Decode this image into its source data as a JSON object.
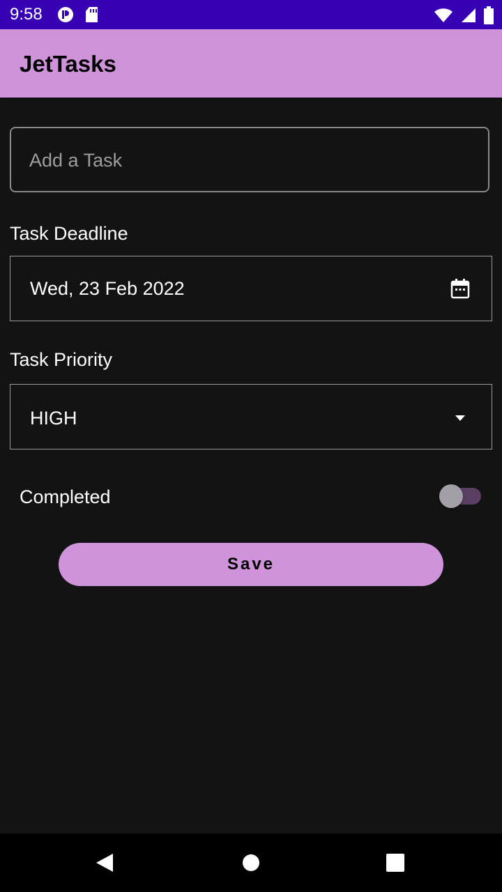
{
  "status_bar": {
    "time": "9:58",
    "icons": [
      "app-notification-icon",
      "sd-card-icon",
      "wifi-icon",
      "signal-icon",
      "battery-icon"
    ],
    "color": "#3700b3"
  },
  "app_bar": {
    "title": "JetTasks",
    "color": "#ce93d8"
  },
  "task_input": {
    "placeholder": "Add a Task",
    "value": ""
  },
  "deadline": {
    "label": "Task Deadline",
    "value": "Wed, 23 Feb 2022",
    "icon": "calendar-icon"
  },
  "priority": {
    "label": "Task Priority",
    "value": "HIGH",
    "icon": "dropdown-arrow-icon"
  },
  "completed": {
    "label": "Completed",
    "checked": false
  },
  "save_button": {
    "label": "Save",
    "color": "#ce93d8"
  },
  "nav_bar": {
    "icons": [
      "back-icon",
      "home-icon",
      "recents-icon"
    ]
  },
  "colors": {
    "background": "#131313",
    "accent": "#ce93d8",
    "status_bar": "#3700b3"
  }
}
